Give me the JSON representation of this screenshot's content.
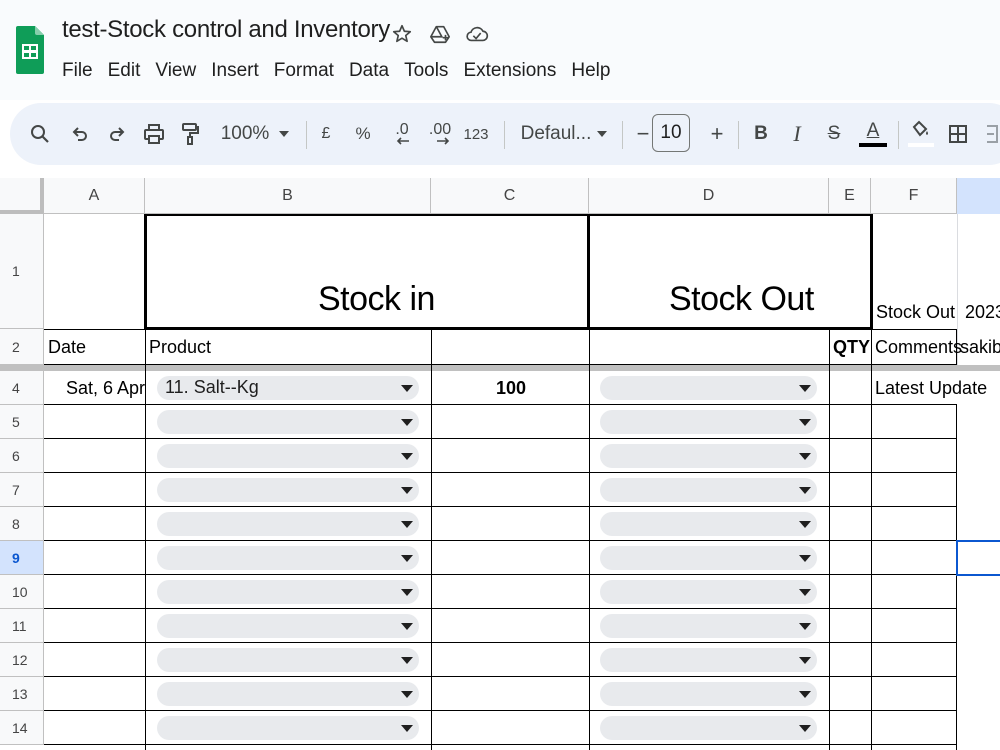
{
  "app": {
    "title": "test-Stock control and Inventory",
    "menu": [
      "File",
      "Edit",
      "View",
      "Insert",
      "Format",
      "Data",
      "Tools",
      "Extensions",
      "Help"
    ]
  },
  "toolbar": {
    "zoom": "100%",
    "currency": "£",
    "percent": "%",
    "decrease_decimal": ".0",
    "increase_decimal": ".00",
    "number_format": "123",
    "font": "Defaul...",
    "font_size": "10",
    "minus": "−",
    "plus": "+",
    "bold": "B",
    "italic": "I",
    "strike": "S",
    "text_color_glyph": "A",
    "text_color": "#000000"
  },
  "sheet": {
    "columns": [
      "A",
      "B",
      "C",
      "D",
      "E",
      "F"
    ],
    "rows": [
      "1",
      "2",
      "4",
      "5",
      "6",
      "7",
      "8",
      "9",
      "10",
      "11",
      "12",
      "13",
      "14"
    ],
    "selected_row": "9",
    "row1": {
      "stock_in": "Stock in",
      "stock_out": "Stock Out",
      "f": "Stock Out",
      "g": "2023"
    },
    "row2": {
      "a": "Date",
      "b": "Product",
      "e": "QTY",
      "f": "Comments",
      "g": "sakib"
    },
    "row4": {
      "a": "Sat, 6 Apr",
      "b": "11. Salt--Kg",
      "c": "100",
      "f": "Latest Update"
    }
  },
  "colors": {
    "accent": "#0b57d0",
    "selected_header": "#d3e3fd",
    "toolbar_bg": "#edf2fa",
    "chip_bg": "#e8eaed",
    "sheets_green": "#0f9d58"
  }
}
